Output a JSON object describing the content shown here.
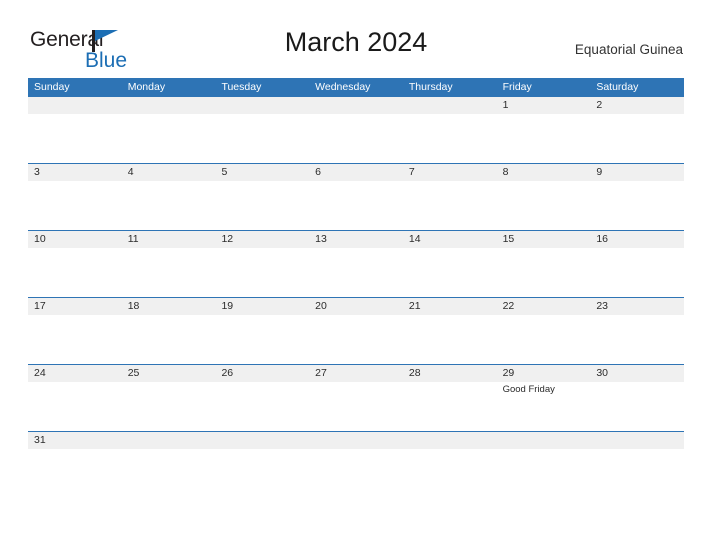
{
  "brand": {
    "name_part1": "General",
    "name_part2": "Blue",
    "mark_icon": "triangle-flag-icon",
    "accent_color": "#1c6eb4"
  },
  "header": {
    "title": "March 2024",
    "locale": "Equatorial Guinea"
  },
  "calendar": {
    "header_bg_color": "#2e74b5",
    "band_bg_color": "#f0f0f0",
    "weekdays": [
      "Sunday",
      "Monday",
      "Tuesday",
      "Wednesday",
      "Thursday",
      "Friday",
      "Saturday"
    ],
    "weeks": [
      {
        "days": [
          {
            "num": "",
            "event": ""
          },
          {
            "num": "",
            "event": ""
          },
          {
            "num": "",
            "event": ""
          },
          {
            "num": "",
            "event": ""
          },
          {
            "num": "",
            "event": ""
          },
          {
            "num": "1",
            "event": ""
          },
          {
            "num": "2",
            "event": ""
          }
        ]
      },
      {
        "days": [
          {
            "num": "3",
            "event": ""
          },
          {
            "num": "4",
            "event": ""
          },
          {
            "num": "5",
            "event": ""
          },
          {
            "num": "6",
            "event": ""
          },
          {
            "num": "7",
            "event": ""
          },
          {
            "num": "8",
            "event": ""
          },
          {
            "num": "9",
            "event": ""
          }
        ]
      },
      {
        "days": [
          {
            "num": "10",
            "event": ""
          },
          {
            "num": "11",
            "event": ""
          },
          {
            "num": "12",
            "event": ""
          },
          {
            "num": "13",
            "event": ""
          },
          {
            "num": "14",
            "event": ""
          },
          {
            "num": "15",
            "event": ""
          },
          {
            "num": "16",
            "event": ""
          }
        ]
      },
      {
        "days": [
          {
            "num": "17",
            "event": ""
          },
          {
            "num": "18",
            "event": ""
          },
          {
            "num": "19",
            "event": ""
          },
          {
            "num": "20",
            "event": ""
          },
          {
            "num": "21",
            "event": ""
          },
          {
            "num": "22",
            "event": ""
          },
          {
            "num": "23",
            "event": ""
          }
        ]
      },
      {
        "days": [
          {
            "num": "24",
            "event": ""
          },
          {
            "num": "25",
            "event": ""
          },
          {
            "num": "26",
            "event": ""
          },
          {
            "num": "27",
            "event": ""
          },
          {
            "num": "28",
            "event": ""
          },
          {
            "num": "29",
            "event": "Good Friday"
          },
          {
            "num": "30",
            "event": ""
          }
        ]
      },
      {
        "days": [
          {
            "num": "31",
            "event": ""
          },
          {
            "num": "",
            "event": ""
          },
          {
            "num": "",
            "event": ""
          },
          {
            "num": "",
            "event": ""
          },
          {
            "num": "",
            "event": ""
          },
          {
            "num": "",
            "event": ""
          },
          {
            "num": "",
            "event": ""
          }
        ]
      }
    ]
  }
}
